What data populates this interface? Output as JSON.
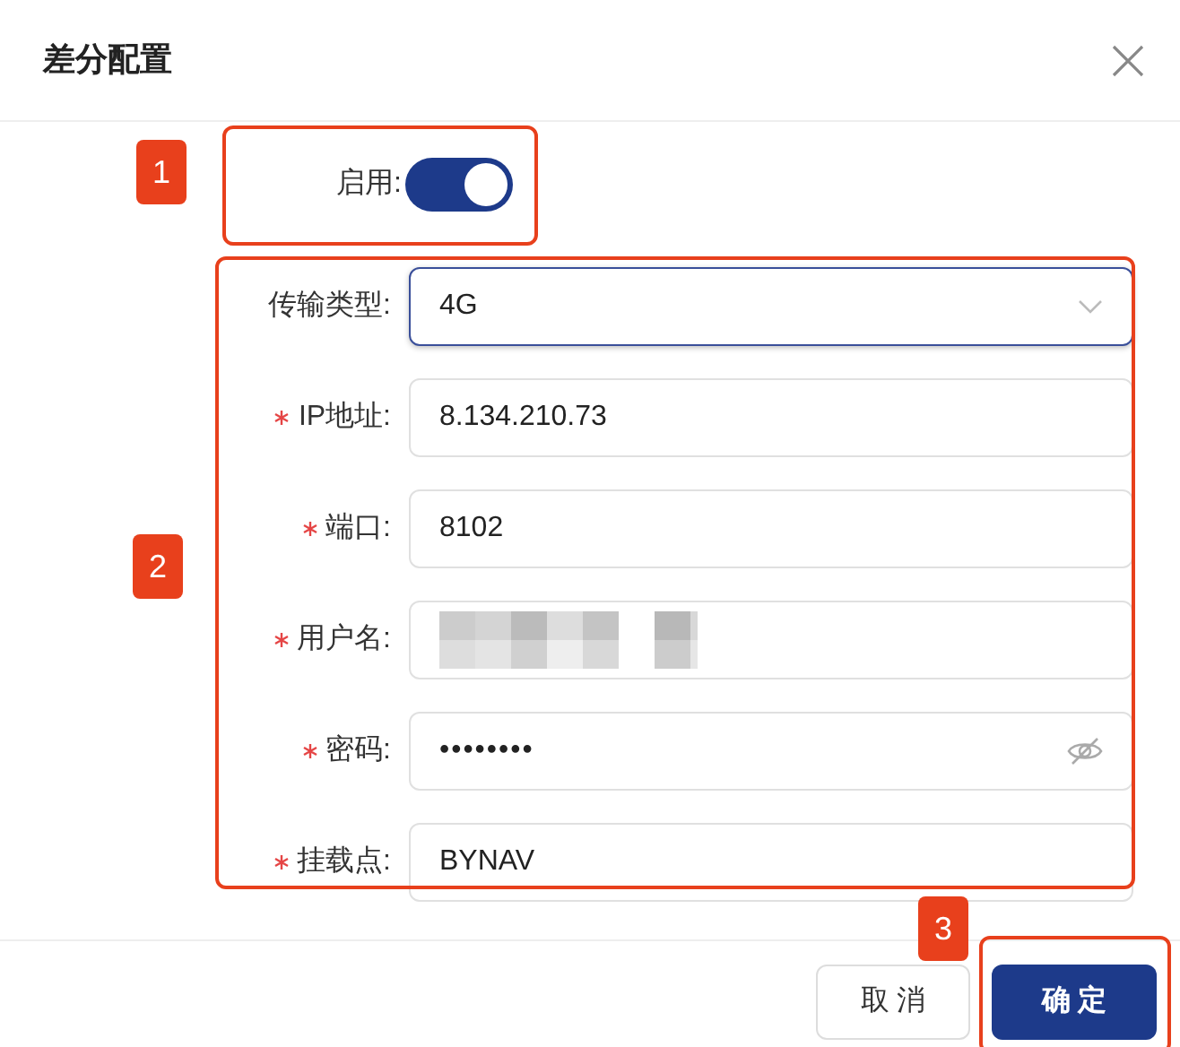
{
  "dialog": {
    "title": "差分配置"
  },
  "enable": {
    "label": "启用:",
    "on": true
  },
  "fields": [
    {
      "kind": "select",
      "label": "传输类型:",
      "required": false,
      "value": "4G",
      "focused": true
    },
    {
      "kind": "text",
      "label": "IP地址:",
      "required": true,
      "value": "8.134.210.73",
      "focused": false
    },
    {
      "kind": "text",
      "label": "端口:",
      "required": true,
      "value": "8102",
      "focused": false
    },
    {
      "kind": "redacted",
      "label": "用户名:",
      "required": true,
      "focused": false
    },
    {
      "kind": "password",
      "label": "密码:",
      "required": true,
      "value": "••••••••",
      "focused": false
    },
    {
      "kind": "text",
      "label": "挂载点:",
      "required": true,
      "value": "BYNAV",
      "focused": false
    }
  ],
  "buttons": [
    {
      "label": "取 消",
      "primary": false
    },
    {
      "label": "确 定",
      "primary": true
    }
  ],
  "annotations": [
    "1",
    "2",
    "3"
  ]
}
